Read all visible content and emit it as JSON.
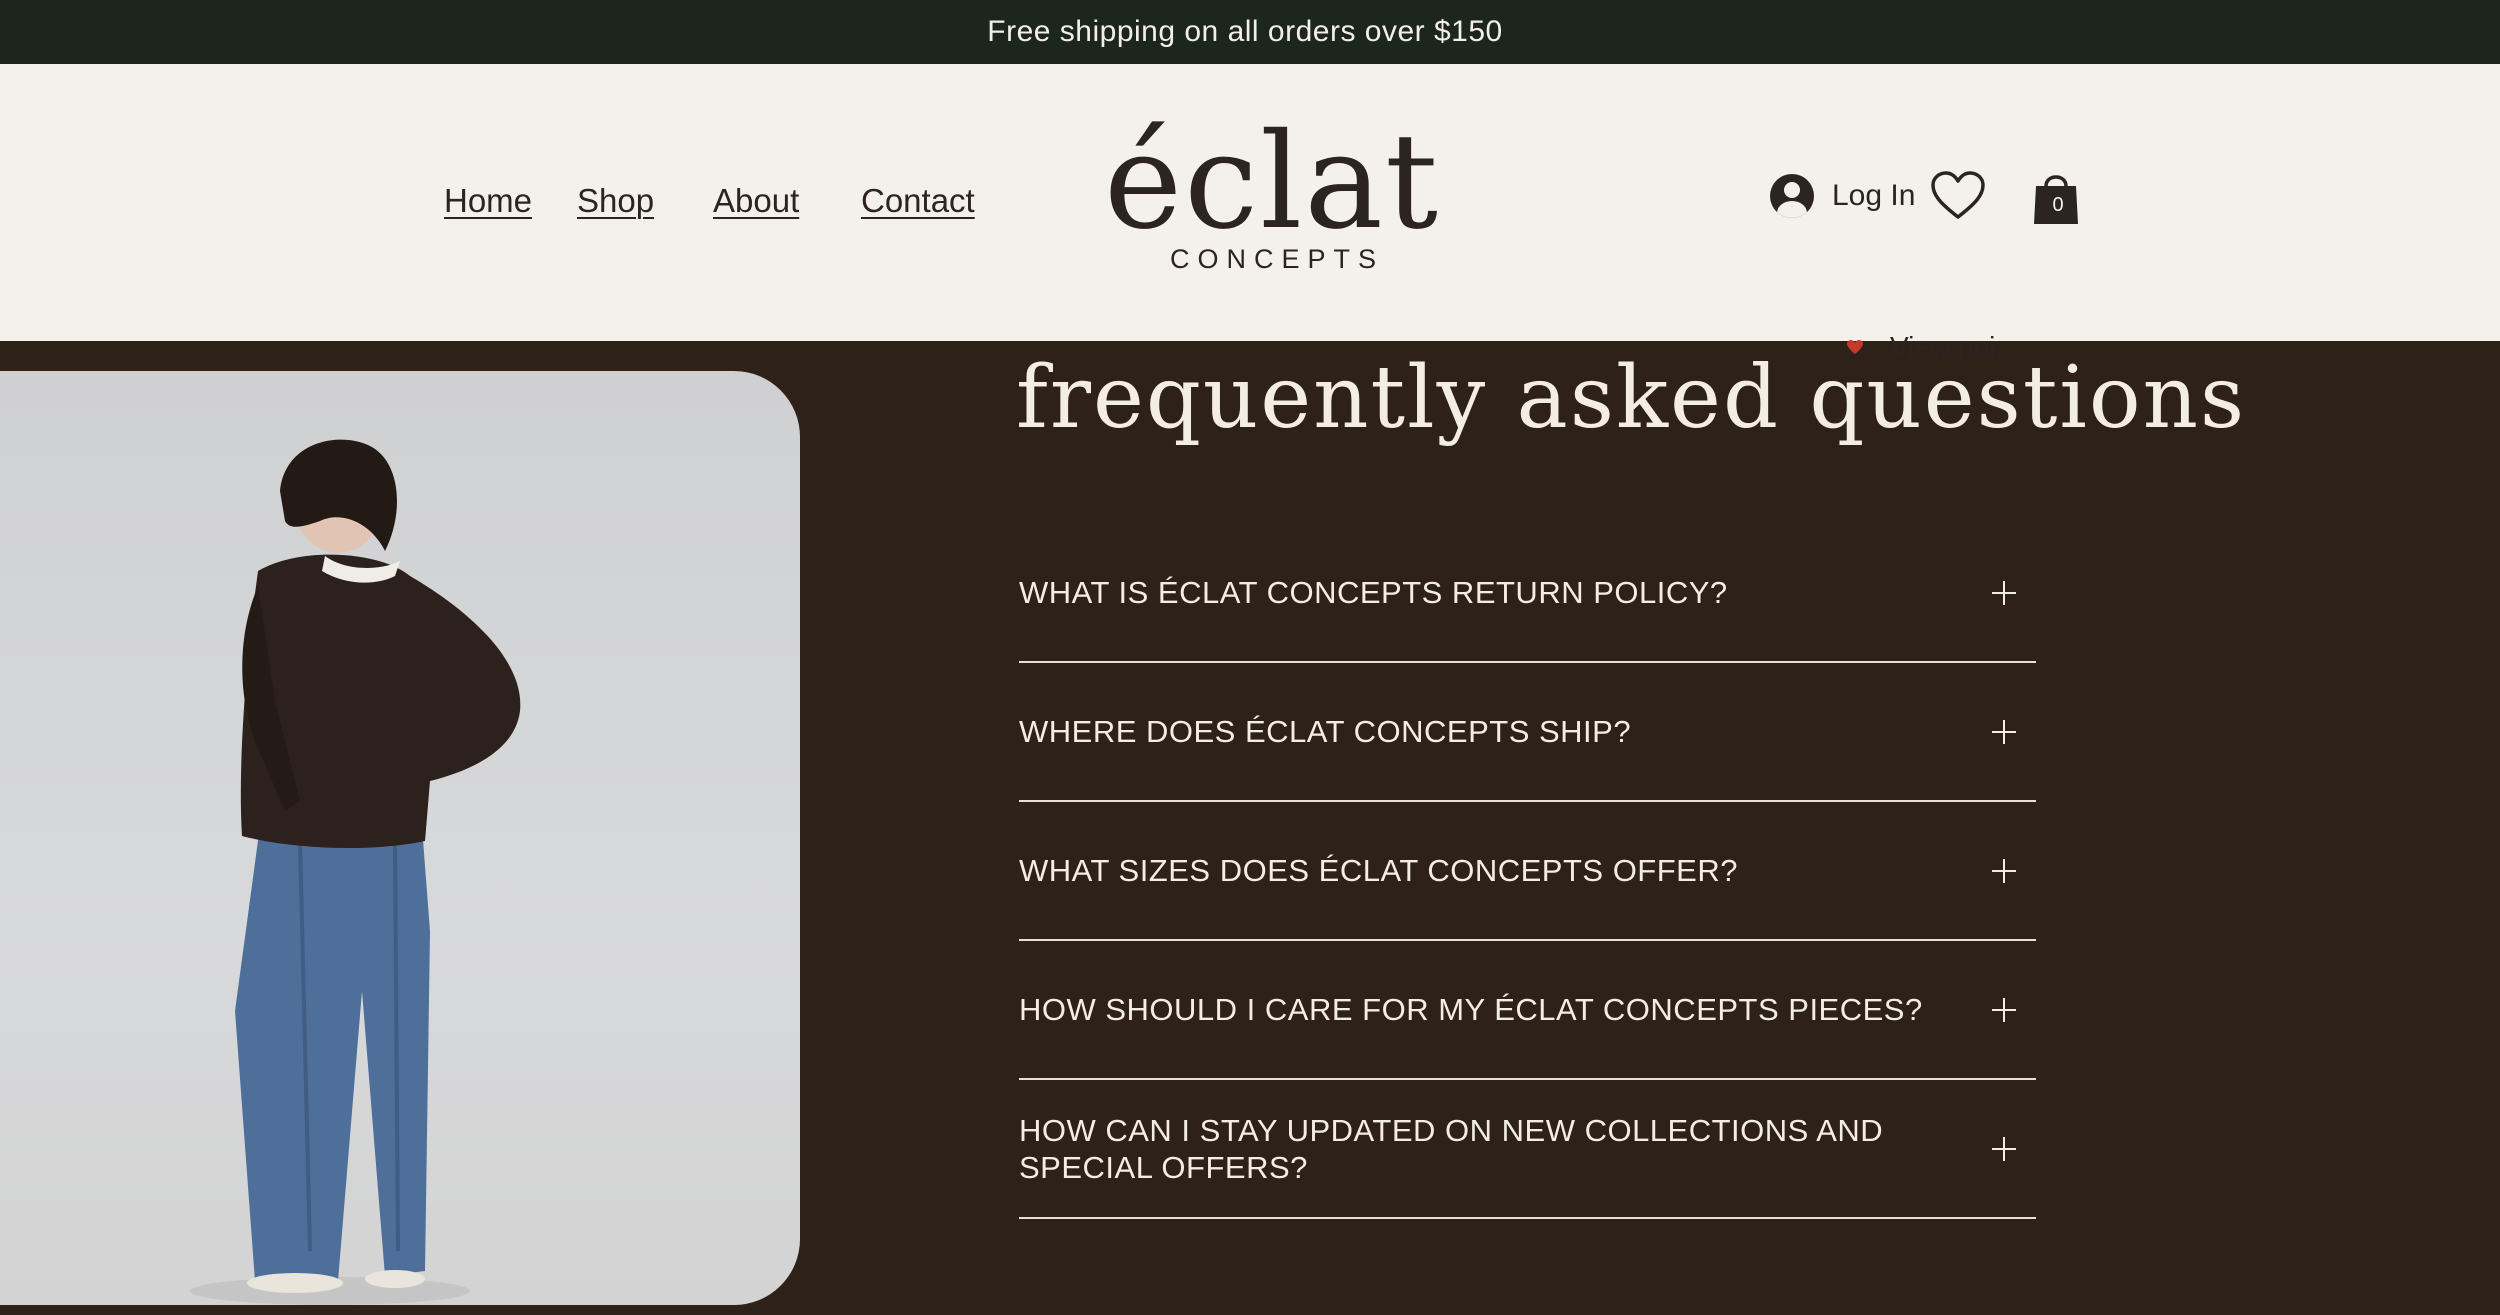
{
  "announcement": {
    "text": "Free shipping on all orders over $150"
  },
  "nav": {
    "items": [
      {
        "label": "Home"
      },
      {
        "label": "Shop"
      },
      {
        "label": "About"
      },
      {
        "label": "Contact"
      }
    ]
  },
  "logo": {
    "main": "éclat",
    "sub": "CONCEPTS"
  },
  "account": {
    "login_label": "Log In",
    "cart_count": "0",
    "points_label": "View poi..."
  },
  "faq": {
    "title": "frequently asked questions",
    "items": [
      {
        "question": "WHAT IS ÉCLAT CONCEPTS RETURN POLICY?"
      },
      {
        "question": "WHERE DOES ÉCLAT CONCEPTS SHIP?"
      },
      {
        "question": "WHAT SIZES DOES ÉCLAT CONCEPTS OFFER?"
      },
      {
        "question": "HOW SHOULD I CARE FOR MY ÉCLAT CONCEPTS PIECES?"
      },
      {
        "question": "HOW CAN I STAY UPDATED ON NEW COLLECTIONS AND SPECIAL OFFERS?"
      }
    ]
  },
  "colors": {
    "announcement_bg": "#1c261d",
    "header_bg": "#f4f1ea",
    "main_bg": "#2e2118",
    "text_light": "#f4ede2",
    "text_dark": "#2b2420"
  }
}
